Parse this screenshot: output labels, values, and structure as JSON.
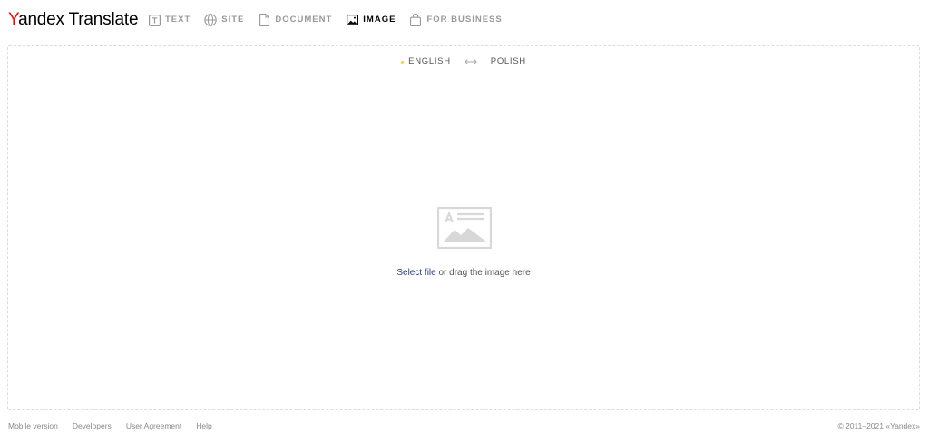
{
  "header": {
    "logo_first_letter": "Y",
    "logo_rest": "andex",
    "logo_product": "Translate",
    "nav": [
      {
        "id": "text",
        "label": "TEXT",
        "icon": "text-icon",
        "active": false
      },
      {
        "id": "site",
        "label": "SITE",
        "icon": "globe-icon",
        "active": false
      },
      {
        "id": "document",
        "label": "DOCUMENT",
        "icon": "document-icon",
        "active": false
      },
      {
        "id": "image",
        "label": "IMAGE",
        "icon": "image-icon",
        "active": true
      },
      {
        "id": "business",
        "label": "FOR BUSINESS",
        "icon": "bag-icon",
        "active": false
      }
    ]
  },
  "languages": {
    "source": "ENGLISH",
    "target": "POLISH",
    "swap_icon": "swap-arrows-icon"
  },
  "dropzone": {
    "placeholder_icon": "image-placeholder-icon",
    "select_file": "Select file",
    "drag_text": " or drag the image here"
  },
  "footer": {
    "links": [
      "Mobile version",
      "Developers",
      "User Agreement",
      "Help"
    ],
    "copyright": "© 2011–2021 «Yandex»"
  },
  "colors": {
    "logo_red": "#ff0000",
    "accent_dot": "#ffcc33",
    "link_blue": "#2b3a8f",
    "muted": "#999999"
  }
}
